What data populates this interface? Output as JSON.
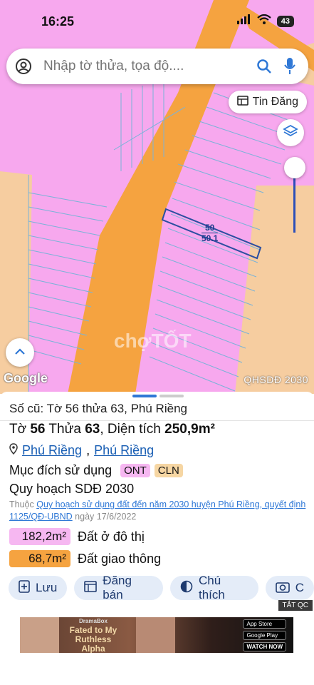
{
  "status_bar": {
    "time": "16:25",
    "battery": "43"
  },
  "search": {
    "placeholder": "Nhập tờ thửa, tọa độ...."
  },
  "map": {
    "tin_dang_label": "Tin Đăng",
    "plot_number": "50",
    "plot_area_label": "50.1",
    "google_logo": "Google",
    "layer_label": "QHSDĐ 2030",
    "watermark": "chợTỐT",
    "colors": {
      "residential": "#f7a8ee",
      "road": "#f5a340",
      "plot_border": "#2b4fa0"
    }
  },
  "sheet": {
    "old_info": "Số cũ: Tờ 56 thửa 63, Phú Riềng",
    "main_prefix_to": "Tờ ",
    "to_value": "56",
    "thua_prefix": " Thửa ",
    "thua_value": "63",
    "area_prefix": ", Diện tích ",
    "area_value": "250,9m²",
    "location_1": "Phú Riềng",
    "location_sep": ",",
    "location_2": "Phú Riềng",
    "purpose_label": "Mục đích sử dụng",
    "purpose_tags": [
      "ONT",
      "CLN"
    ],
    "plan_label": "Quy hoạch SDĐ 2030",
    "ref_prefix": "Thuộc ",
    "ref_link": "Quy hoạch sử dụng đất đến năm 2030 huyện Phú Riềng, quyết định 1125/QĐ-UBND",
    "ref_date": " ngày 17/6/2022",
    "areas": [
      {
        "value": "182,2m²",
        "label": "Đất ở đô thị",
        "color": "#f6b7f1"
      },
      {
        "value": "68,7m²",
        "label": "Đất giao thông",
        "color": "#f5a340"
      }
    ],
    "actions": [
      "Lưu",
      "Đăng bán",
      "Chú thích",
      "C"
    ],
    "ad_close": "TẮT QC",
    "ad": {
      "title": "Fated to My Ruthless Alpha",
      "brand": "DramaBox",
      "store_1": "App Store",
      "store_2": "Google Play",
      "cta": "WATCH NOW"
    }
  }
}
